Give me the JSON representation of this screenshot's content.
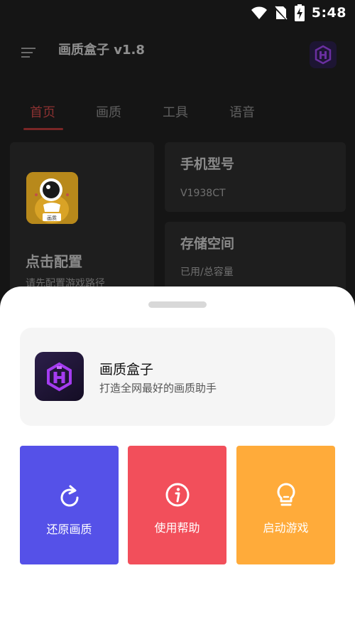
{
  "status_bar": {
    "time": "5:48",
    "icons": [
      "wifi-icon",
      "no-sim-icon",
      "battery-charging-icon"
    ]
  },
  "app_bar": {
    "title": "画质盒子 v1.8",
    "menu_icon": "menu-icon",
    "logo_icon": "app-logo-icon"
  },
  "tabs": [
    {
      "label": "首页",
      "active": true
    },
    {
      "label": "画质",
      "active": false
    },
    {
      "label": "工具",
      "active": false
    },
    {
      "label": "语音",
      "active": false
    }
  ],
  "config_card": {
    "title": "点击配置",
    "subtitle": "请先配置游戏路径",
    "icon_caption": "画质"
  },
  "phone_card": {
    "label": "手机型号",
    "value": "V1938CT"
  },
  "storage_card": {
    "label": "存储空间",
    "value": "已用/总容量"
  },
  "sheet": {
    "app_name": "画质盒子",
    "app_slogan": "打造全网最好的画质助手",
    "actions": [
      {
        "label": "还原画质",
        "icon": "refresh-icon",
        "color": "#5551e8"
      },
      {
        "label": "使用帮助",
        "icon": "info-icon",
        "color": "#f24f5b"
      },
      {
        "label": "启动游戏",
        "icon": "lightbulb-icon",
        "color": "#ffab3a"
      }
    ]
  },
  "colors": {
    "accent": "#8a3131",
    "logo_purple": "#a43cf0"
  }
}
